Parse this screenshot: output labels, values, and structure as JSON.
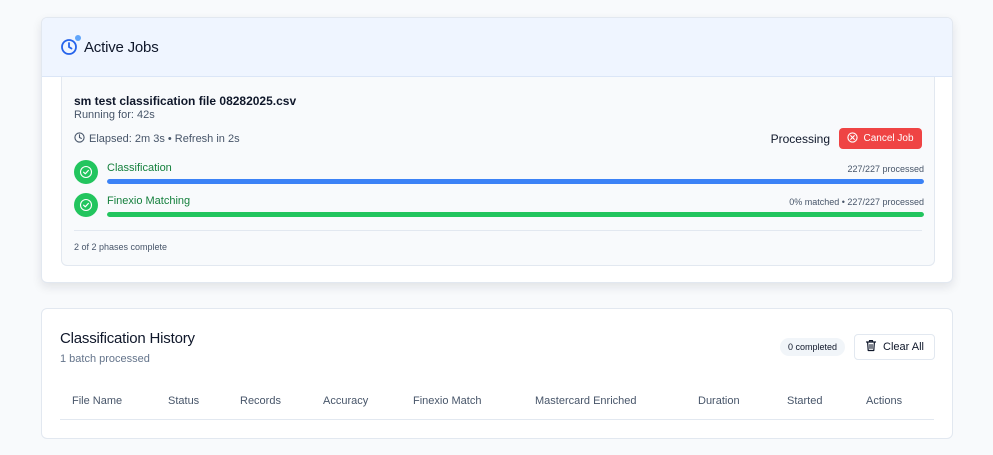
{
  "active_jobs": {
    "title": "Active Jobs",
    "icon": "clock-icon",
    "job": {
      "file_name": "sm test classification file 08282025.csv",
      "running_for": "Running for: 42s",
      "elapsed": "Elapsed: 2m 3s • Refresh in 2s",
      "status": "Processing",
      "cancel_label": "Cancel Job",
      "phases": [
        {
          "name": "Classification",
          "meta": "227/227 processed",
          "progress": 1.0,
          "color": "#3b82f6"
        },
        {
          "name": "Finexio Matching",
          "meta": "0% matched • 227/227 processed",
          "progress": 1.0,
          "color": "#22c55e"
        }
      ],
      "footer": "2 of 2 phases complete"
    }
  },
  "history": {
    "title": "Classification History",
    "subtitle": "1 batch processed",
    "completed_badge": "0 completed",
    "clear_label": "Clear All",
    "columns": [
      "File Name",
      "Status",
      "Records",
      "Accuracy",
      "Finexio Match",
      "Mastercard Enriched",
      "Duration",
      "Started",
      "Actions"
    ]
  },
  "colors": {
    "accent_blue": "#3b82f6",
    "success_green": "#22c55e",
    "danger_red": "#ef4444"
  }
}
